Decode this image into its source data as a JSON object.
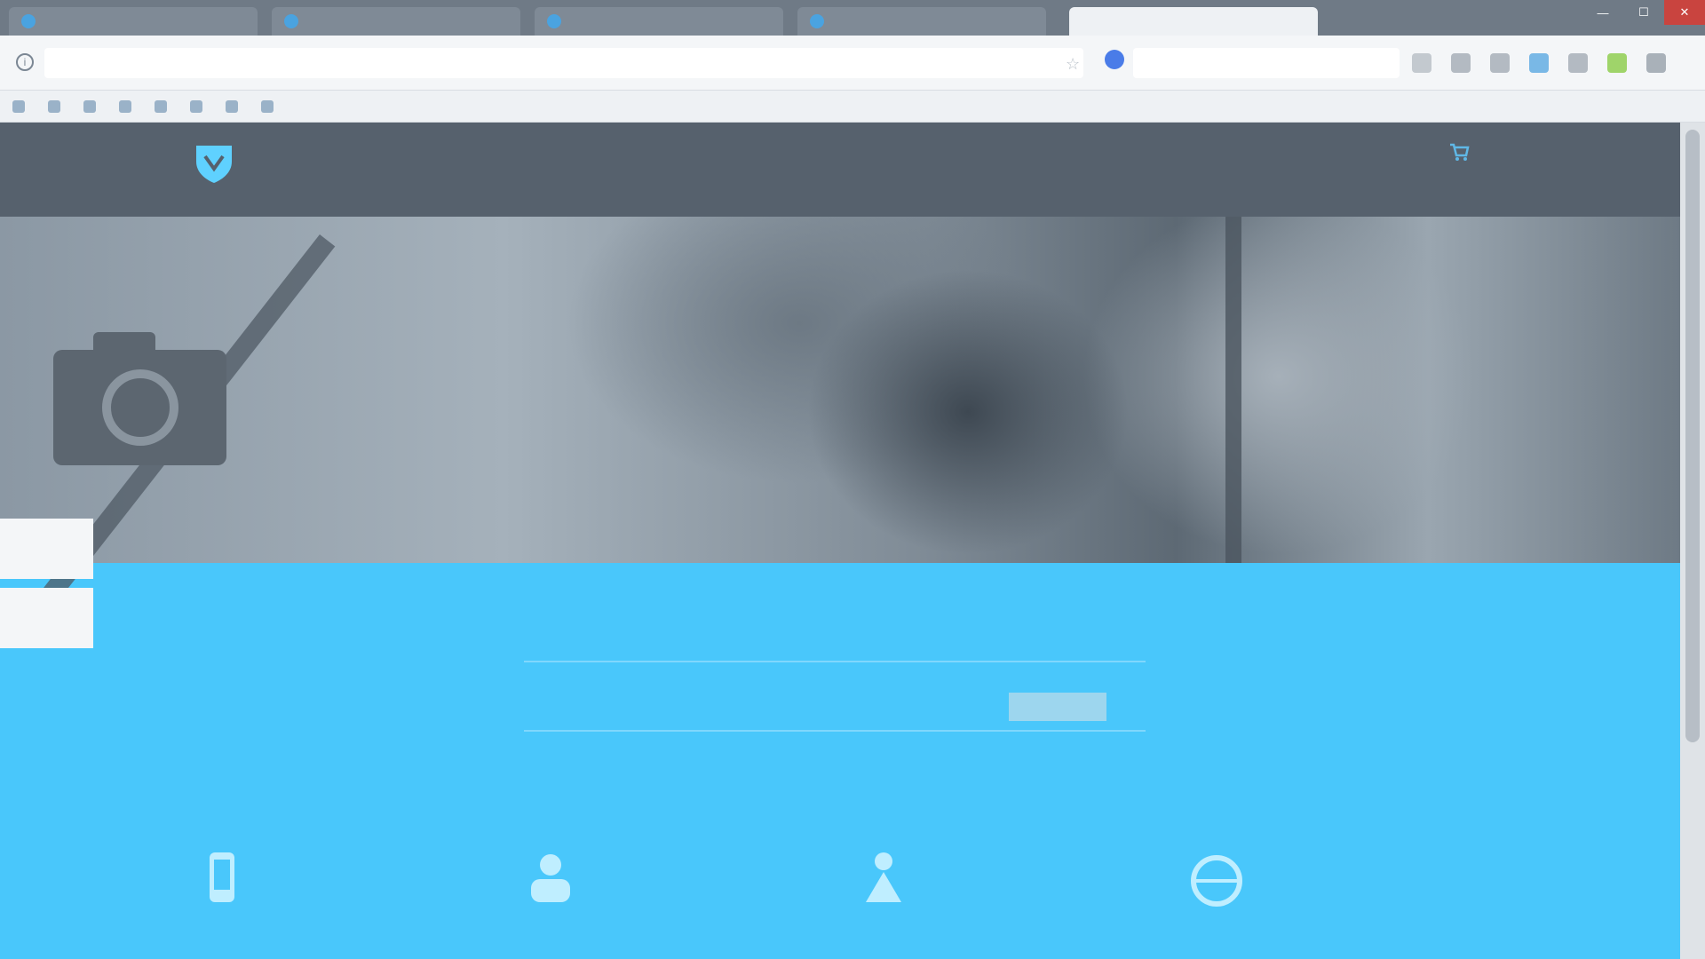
{
  "browser": {
    "tabs": [
      {
        "label": ""
      },
      {
        "label": ""
      },
      {
        "label": ""
      },
      {
        "label": ""
      },
      {
        "label": ""
      }
    ],
    "address": "",
    "search_placeholder": "",
    "bookmarks": [
      {
        "label": ""
      },
      {
        "label": ""
      },
      {
        "label": ""
      },
      {
        "label": ""
      },
      {
        "label": ""
      },
      {
        "label": ""
      },
      {
        "label": ""
      },
      {
        "label": ""
      }
    ]
  },
  "site": {
    "logo_text": "",
    "nav": [
      "",
      "",
      "",
      "",
      "",
      ""
    ]
  },
  "hero": {
    "side_tabs": [
      "",
      ""
    ]
  },
  "subscribe": {
    "placeholder": "",
    "button_label": "",
    "section_label": ""
  },
  "colors": {
    "accent": "#49c7fb",
    "header": "#56616d",
    "close_button": "#c9443f"
  },
  "icons": {
    "features": [
      "phone-icon",
      "user-group-icon",
      "person-icon",
      "globe-icon"
    ]
  }
}
